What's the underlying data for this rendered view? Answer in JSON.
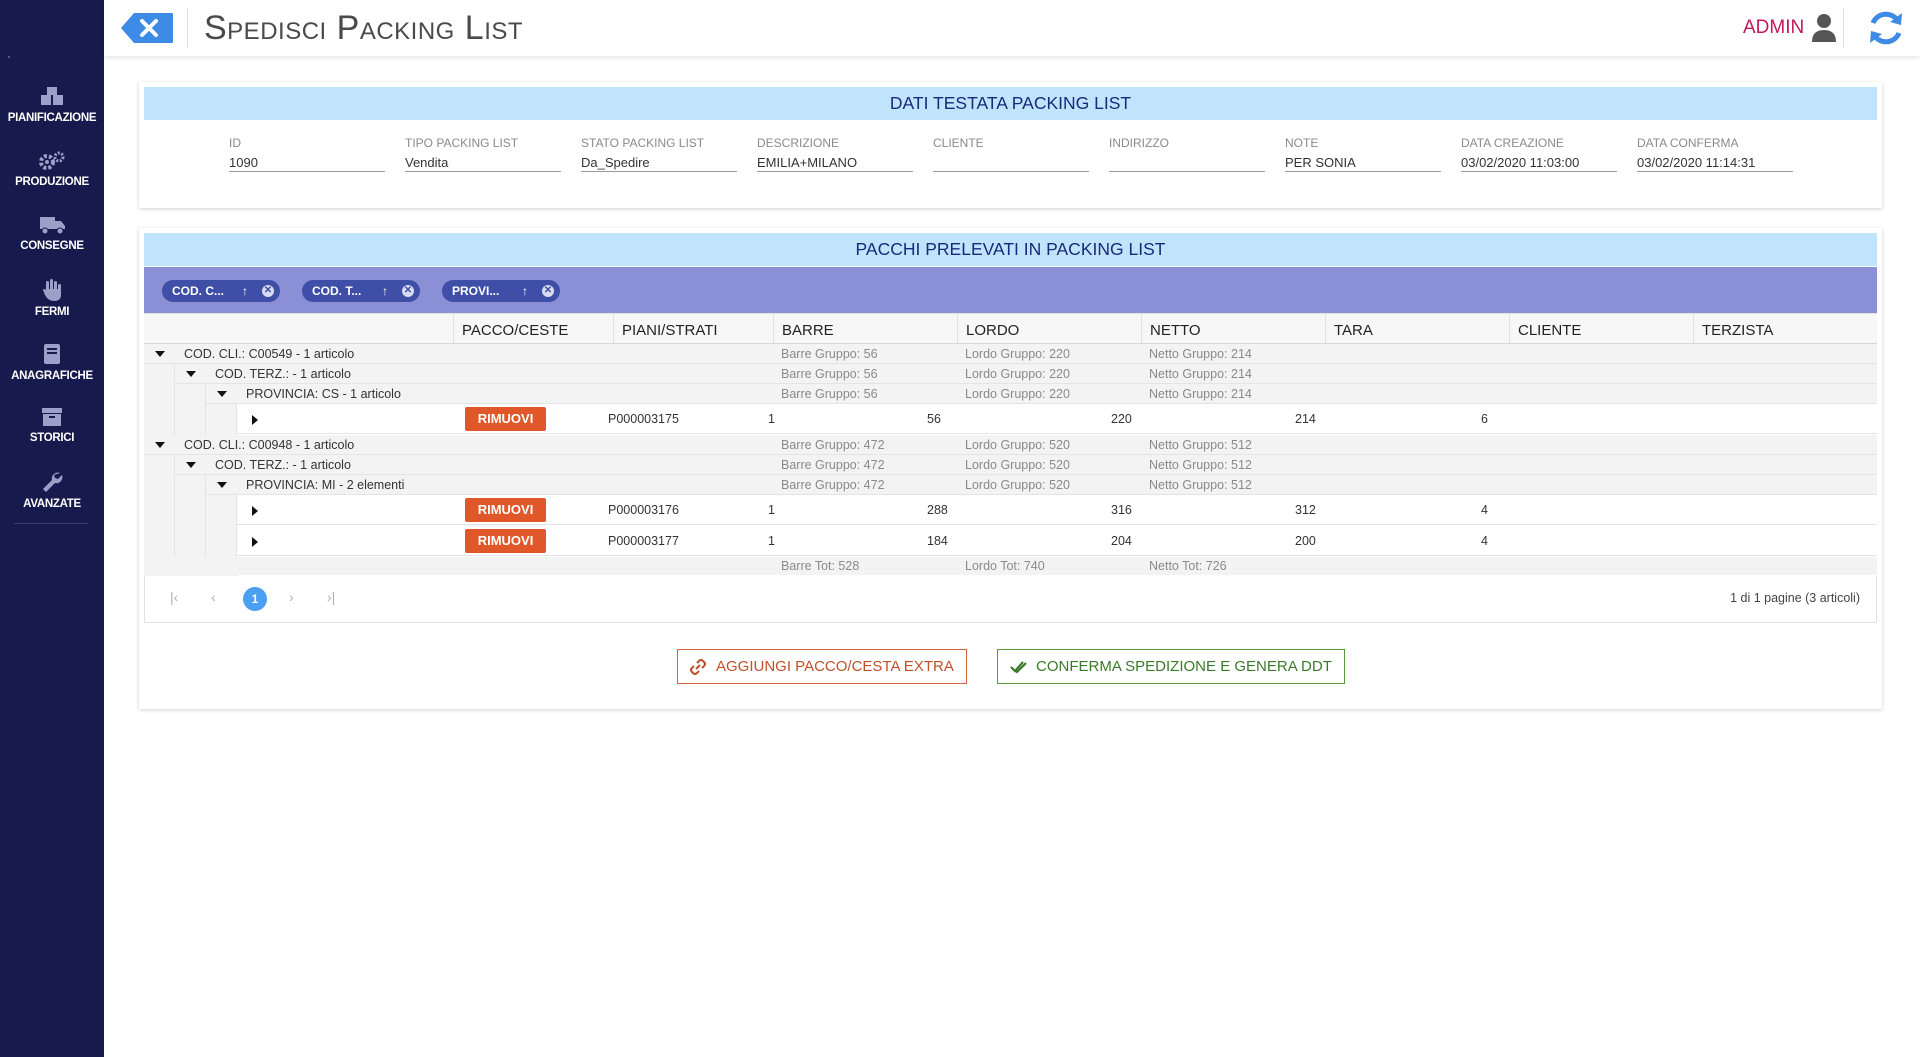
{
  "sidebar": {
    "items": [
      {
        "label": "PIANIFICAZIONE",
        "icon": "boxes-icon"
      },
      {
        "label": "PRODUZIONE",
        "icon": "gears-icon"
      },
      {
        "label": "CONSEGNE",
        "icon": "truck-icon"
      },
      {
        "label": "FERMI",
        "icon": "hand-icon"
      },
      {
        "label": "ANAGRAFICHE",
        "icon": "book-icon"
      },
      {
        "label": "STORICI",
        "icon": "archive-icon"
      },
      {
        "label": "AVANZATE",
        "icon": "wrench-icon"
      }
    ]
  },
  "header": {
    "title": "Spedisci Packing List",
    "user": "ADMIN",
    "colors": {
      "accent": "#3d8be6",
      "user": "#c2185b",
      "sidebar": "#161a4c"
    }
  },
  "testata": {
    "title": "DATI TESTATA PACKING LIST",
    "fields": [
      {
        "label": "ID",
        "value": "1090"
      },
      {
        "label": "TIPO PACKING LIST",
        "value": "Vendita"
      },
      {
        "label": "STATO PACKING LIST",
        "value": "Da_Spedire"
      },
      {
        "label": "DESCRIZIONE",
        "value": "EMILIA+MILANO"
      },
      {
        "label": "CLIENTE",
        "value": ""
      },
      {
        "label": "INDIRIZZO",
        "value": ""
      },
      {
        "label": "NOTE",
        "value": "PER SONIA"
      },
      {
        "label": "DATA CREAZIONE",
        "value": "03/02/2020 11:03:00"
      },
      {
        "label": "DATA CONFERMA",
        "value": "03/02/2020 11:14:31"
      }
    ]
  },
  "pacchi": {
    "title": "PACCHI PRELEVATI IN PACKING LIST",
    "chips": [
      "COD. C...",
      "COD. T...",
      "PROVI..."
    ],
    "columns": [
      "PACCO/CESTE",
      "PIANI/STRATI",
      "BARRE",
      "LORDO",
      "NETTO",
      "TARA",
      "CLIENTE",
      "TERZISTA"
    ],
    "remove_label": "RIMUOVI",
    "groups": [
      {
        "l1": "COD. CLI.: C00549 - 1 articolo",
        "barre": "Barre Gruppo: 56",
        "lordo": "Lordo Gruppo: 220",
        "netto": "Netto Gruppo: 214"
      },
      {
        "l2": "COD. TERZ.: - 1 articolo",
        "barre": "Barre Gruppo: 56",
        "lordo": "Lordo Gruppo: 220",
        "netto": "Netto Gruppo: 214"
      },
      {
        "l3": "PROVINCIA: CS - 1 articolo",
        "barre": "Barre Gruppo: 56",
        "lordo": "Lordo Gruppo: 220",
        "netto": "Netto Gruppo: 214"
      },
      {
        "l1": "COD. CLI.: C00948 - 1 articolo",
        "barre": "Barre Gruppo: 472",
        "lordo": "Lordo Gruppo: 520",
        "netto": "Netto Gruppo: 512"
      },
      {
        "l2": "COD. TERZ.: - 1 articolo",
        "barre": "Barre Gruppo: 472",
        "lordo": "Lordo Gruppo: 520",
        "netto": "Netto Gruppo: 512"
      },
      {
        "l3": "PROVINCIA: MI - 2 elementi",
        "barre": "Barre Gruppo: 472",
        "lordo": "Lordo Gruppo: 520",
        "netto": "Netto Gruppo: 512"
      }
    ],
    "rows": [
      {
        "pacco": "P000003175",
        "piani": "1",
        "barre": "56",
        "lordo": "220",
        "netto": "214",
        "tara": "6",
        "cliente": "",
        "terzista": ""
      },
      {
        "pacco": "P000003176",
        "piani": "1",
        "barre": "288",
        "lordo": "316",
        "netto": "312",
        "tara": "4",
        "cliente": "",
        "terzista": ""
      },
      {
        "pacco": "P000003177",
        "piani": "1",
        "barre": "184",
        "lordo": "204",
        "netto": "200",
        "tara": "4",
        "cliente": "",
        "terzista": ""
      }
    ],
    "totals": {
      "barre": "Barre Tot: 528",
      "lordo": "Lordo Tot: 740",
      "netto": "Netto Tot: 726"
    },
    "pager": {
      "current": "1",
      "info": "1 di 1 pagine (3 articoli)"
    }
  },
  "actions": {
    "extra_label": "AGGIUNGI PACCO/CESTA EXTRA",
    "confirm_label": "CONFERMA SPEDIZIONE E GENERA DDT"
  }
}
